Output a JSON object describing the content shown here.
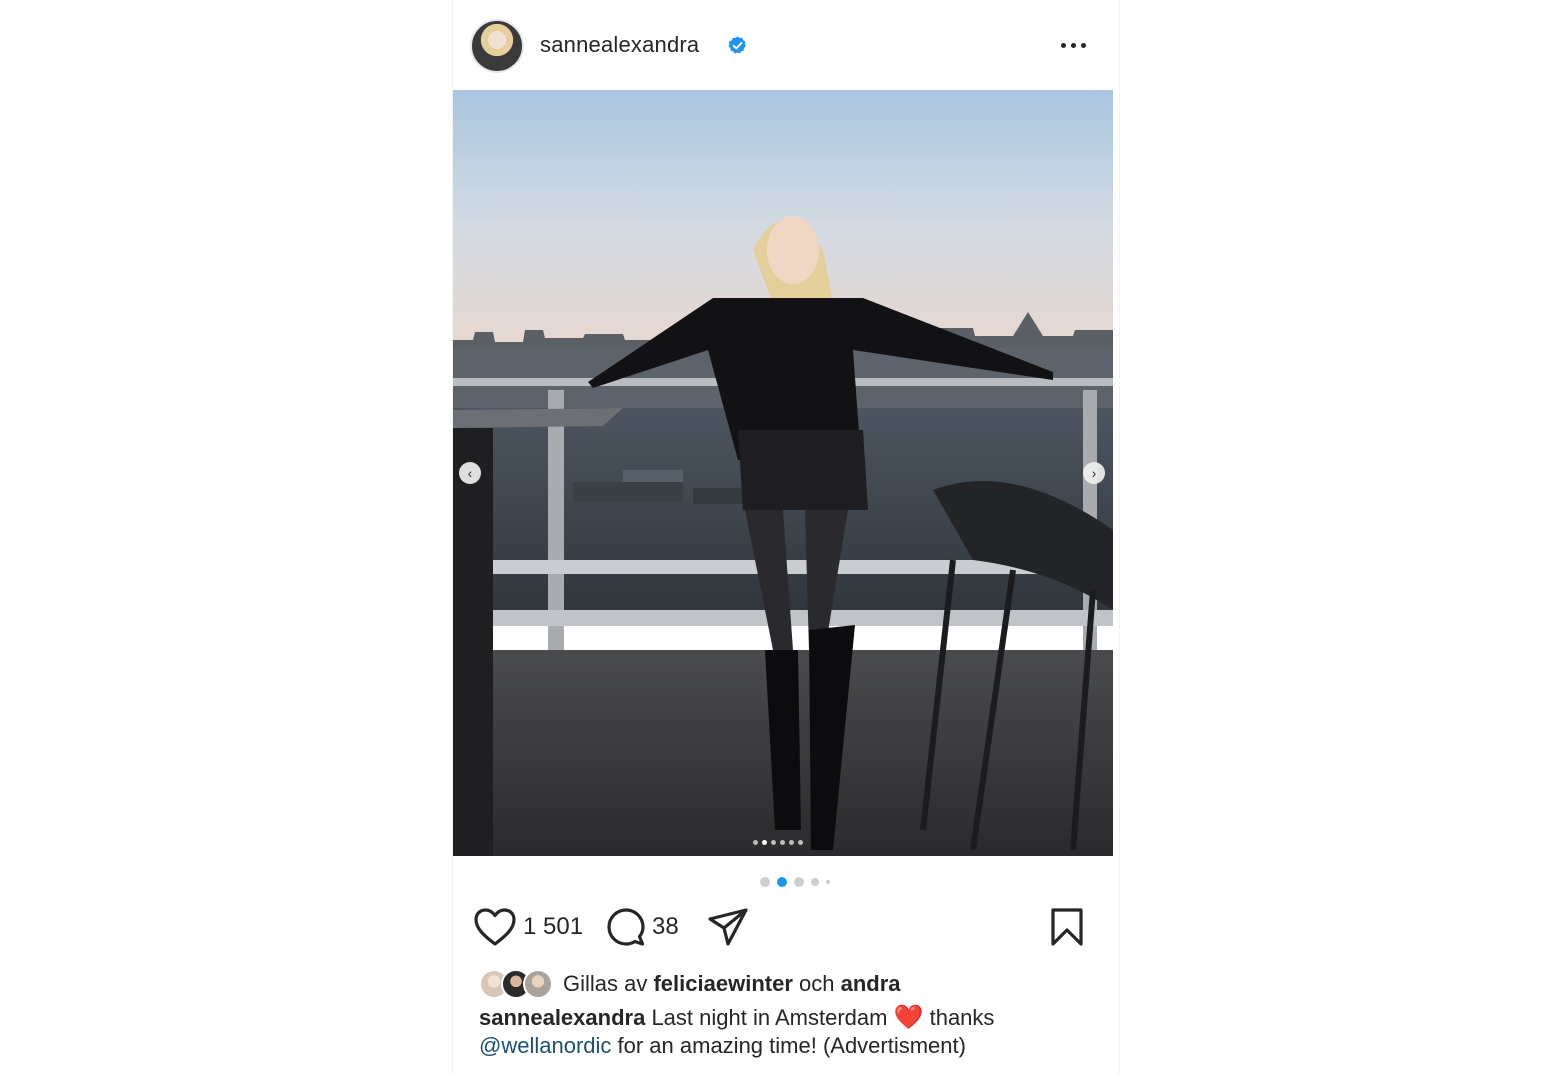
{
  "header": {
    "username": "sannealexandra",
    "verified_icon": "verified-badge-icon",
    "more_icon": "more-options-icon"
  },
  "photo": {
    "carousel_index": 2,
    "carousel_total": 6,
    "prev_icon": "chevron-left-icon",
    "next_icon": "chevron-right-icon"
  },
  "carousel_dots": {
    "active_index": 1,
    "count": 5
  },
  "actions": {
    "like_icon": "heart-icon",
    "like_count": "1 501",
    "comment_icon": "comment-bubble-icon",
    "comment_count": "38",
    "share_icon": "paper-plane-icon",
    "save_icon": "bookmark-icon"
  },
  "liked_by": {
    "prefix": "Gillas av",
    "user": "feliciaewinter",
    "connector": "och",
    "others": "andra"
  },
  "caption": {
    "username": "sannealexandra",
    "text_before": "Last night in Amsterdam",
    "emoji": "❤️",
    "text_after": "thanks",
    "mention": "@wellanordic",
    "text_end": "for an amazing time! (Advertisment)"
  },
  "colors": {
    "verified": "#1e96f0",
    "active_dot": "#1e96f0",
    "mention": "#1c4f7a",
    "heart_emoji": "#e0182d"
  }
}
